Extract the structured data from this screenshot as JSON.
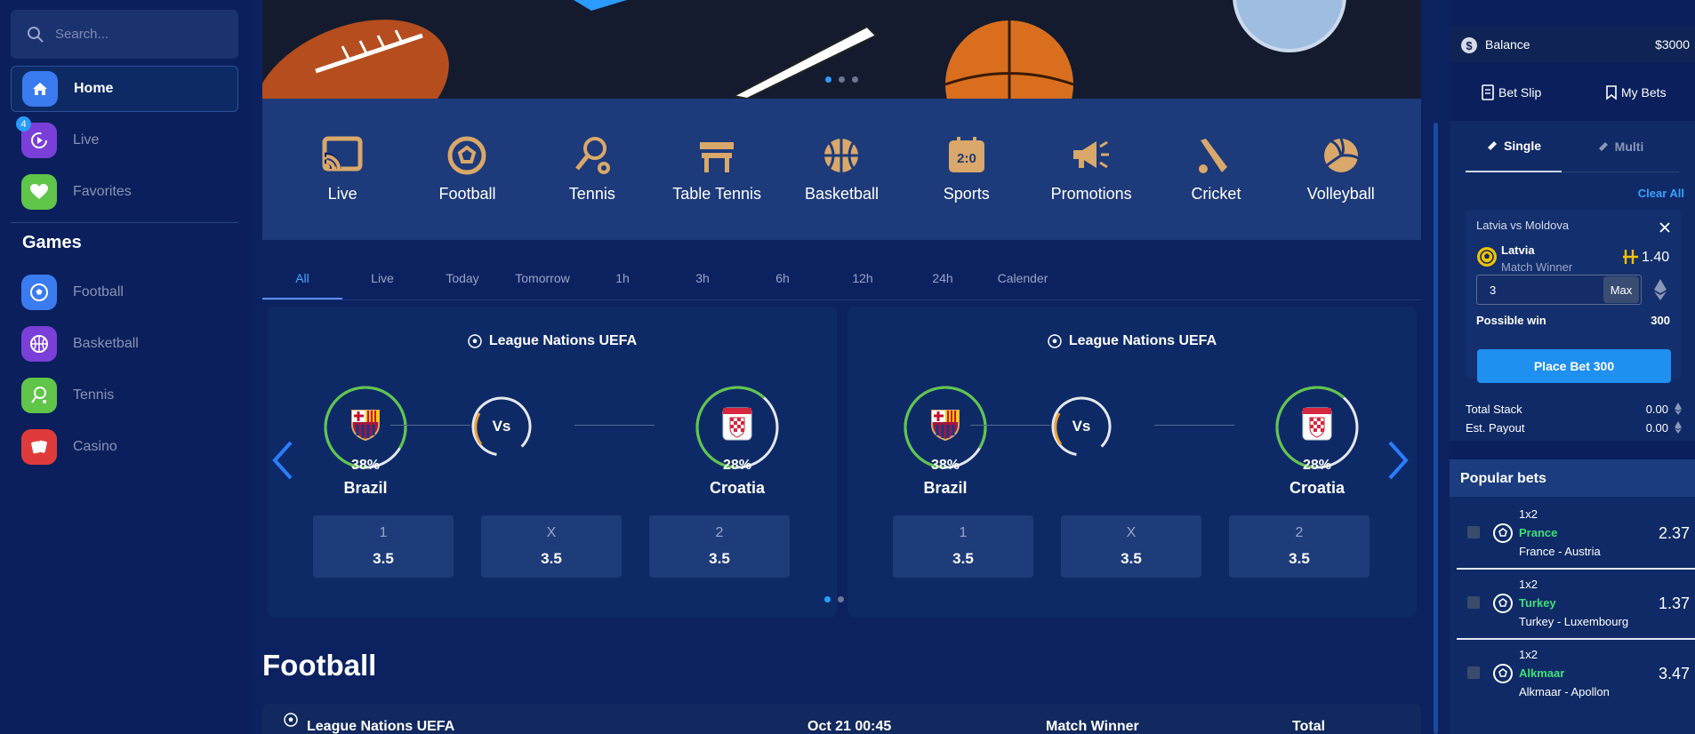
{
  "sidebar": {
    "search_placeholder": "Search...",
    "home": "Home",
    "live": "Live",
    "live_badge": "4",
    "favorites": "Favorites",
    "games_heading": "Games",
    "games": [
      "Football",
      "Basketball",
      "Tennis",
      "Casino"
    ]
  },
  "categories": [
    "Live",
    "Football",
    "Tennis",
    "Table Tennis",
    "Basketball",
    "Sports",
    "Promotions",
    "Cricket",
    "Volleyball"
  ],
  "filters": [
    "All",
    "Live",
    "Today",
    "Tomorrow",
    "1h",
    "3h",
    "6h",
    "12h",
    "24h",
    "Calender"
  ],
  "matches": [
    {
      "league": "League Nations UEFA",
      "home": "Brazil",
      "home_pct": "38%",
      "home_level": 0.38,
      "away": "Croatia",
      "away_pct": "28%",
      "away_level": 0.28,
      "vs": "Vs",
      "odds": [
        {
          "label": "1",
          "value": "3.5"
        },
        {
          "label": "X",
          "value": "3.5"
        },
        {
          "label": "2",
          "value": "3.5"
        }
      ]
    },
    {
      "league": "League Nations UEFA",
      "home": "Brazil",
      "home_pct": "38%",
      "home_level": 0.38,
      "away": "Croatia",
      "away_pct": "28%",
      "away_level": 0.28,
      "vs": "Vs",
      "odds": [
        {
          "label": "1",
          "value": "3.5"
        },
        {
          "label": "X",
          "value": "3.5"
        },
        {
          "label": "2",
          "value": "3.5"
        }
      ]
    }
  ],
  "football_heading": "Football",
  "table_header": {
    "league": "League Nations UEFA",
    "date": "Oct 21 00:45",
    "market": "Match Winner",
    "total": "Total"
  },
  "betslip": {
    "balance_label": "Balance",
    "balance_value": "$3000",
    "bet_slip": "Bet Slip",
    "my_bets": "My Bets",
    "single": "Single",
    "multi": "Multi",
    "clear_all": "Clear All",
    "match": "Latvia vs Moldova",
    "team": "Latvia",
    "market": "Match Winner",
    "odd": "1.40",
    "stake": "3",
    "max": "Max",
    "possible_win_label": "Possible win",
    "possible_win": "300",
    "place_bet": "Place Bet 300",
    "total_stack_label": "Total Stack",
    "total_stack": "0.00",
    "est_payout_label": "Est. Payout",
    "est_payout": "0.00"
  },
  "popular": {
    "heading": "Popular bets",
    "items": [
      {
        "type": "1x2",
        "pick": "Prance",
        "match": "France - Austria",
        "odd": "2.37"
      },
      {
        "type": "1x2",
        "pick": "Turkey",
        "match": "Turkey - Luxembourg",
        "odd": "1.37"
      },
      {
        "type": "1x2",
        "pick": "Alkmaar",
        "match": "Alkmaar - Apollon",
        "odd": "3.47"
      }
    ]
  },
  "colors": {
    "accent": "#2a9bff",
    "gold": "#d9a86a",
    "pick_green": "#3ee07a"
  }
}
